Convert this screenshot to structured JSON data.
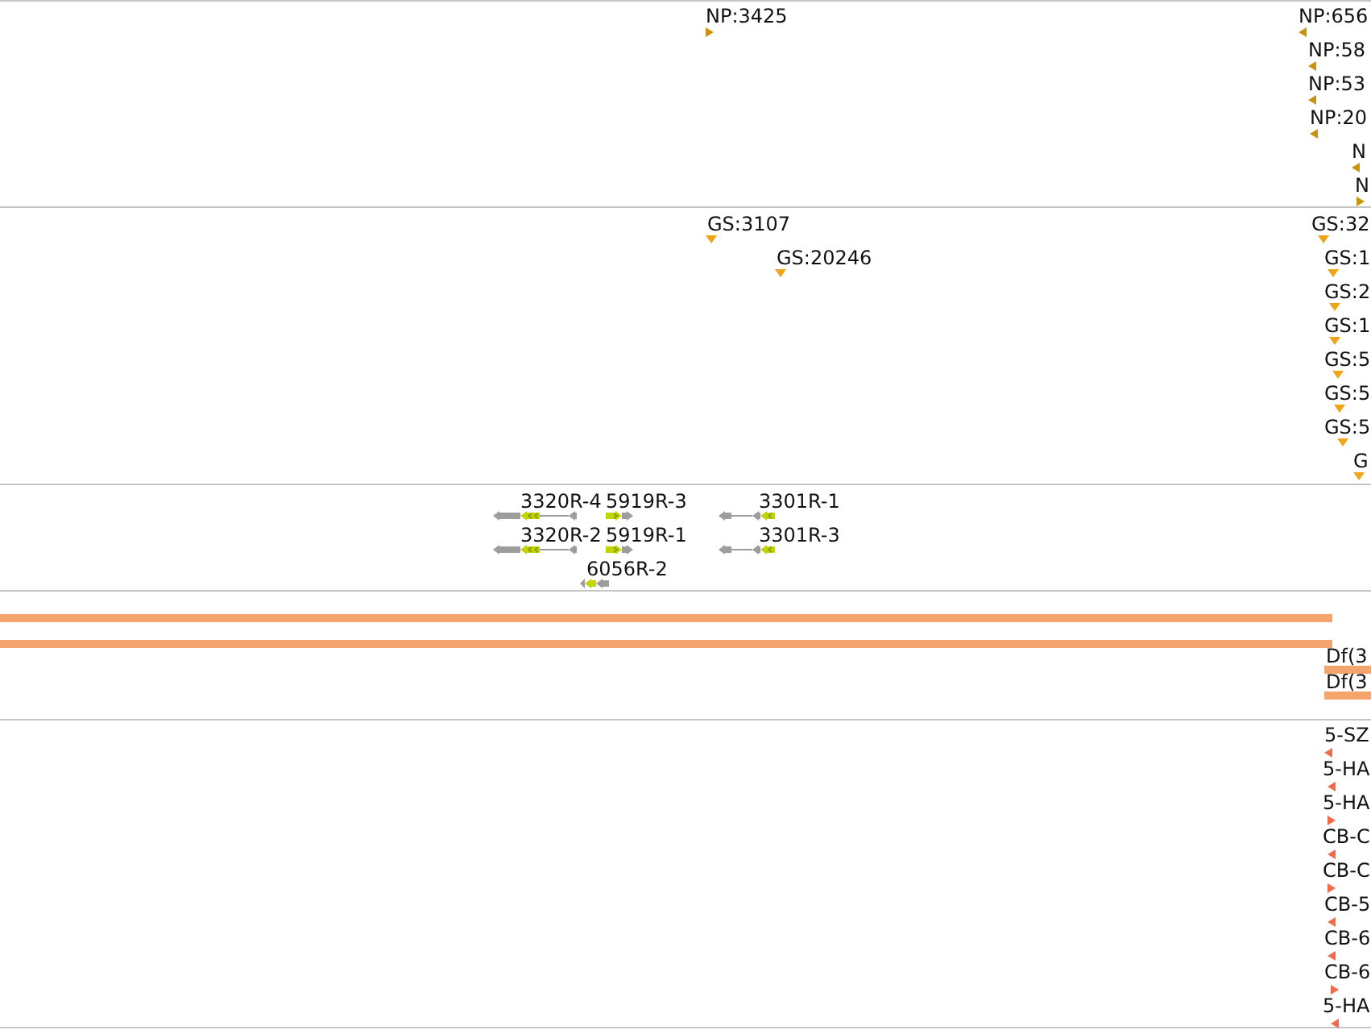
{
  "tracks": [
    {
      "kind": "arrows",
      "features": [
        {
          "label": "NP:3425",
          "reverse": false
        },
        {
          "label": "NP:656",
          "reverse": true
        },
        {
          "label": "NP:58",
          "reverse": true
        },
        {
          "label": "NP:53",
          "reverse": true
        },
        {
          "label": "NP:20",
          "reverse": true
        },
        {
          "label": "N",
          "reverse": true
        },
        {
          "label": "N",
          "reverse": false
        }
      ]
    },
    {
      "kind": "pins",
      "features": [
        {
          "label": "GS:3107"
        },
        {
          "label": "GS:32"
        },
        {
          "label": "GS:20246"
        },
        {
          "label": "GS:1"
        },
        {
          "label": "GS:2"
        },
        {
          "label": "GS:1"
        },
        {
          "label": "GS:5"
        },
        {
          "label": "GS:5"
        },
        {
          "label": "GS:5"
        },
        {
          "label": "G"
        }
      ]
    },
    {
      "kind": "genes",
      "features": [
        {
          "label": "3320R-4",
          "reverse": true
        },
        {
          "label": "5919R-3",
          "reverse": false
        },
        {
          "label": "3301R-1",
          "reverse": true
        },
        {
          "label": "3320R-2",
          "reverse": true
        },
        {
          "label": "5919R-1",
          "reverse": false
        },
        {
          "label": "3301R-3",
          "reverse": true
        },
        {
          "label": "6056R-2",
          "reverse": true
        }
      ]
    },
    {
      "kind": "bars",
      "features": [
        {
          "kind": "plain"
        },
        {
          "kind": "plain"
        },
        {
          "kind": "labeled",
          "label": "Df(3"
        },
        {
          "kind": "labeled",
          "label": "Df(3"
        }
      ]
    },
    {
      "kind": "arrows",
      "features": [
        {
          "label": "5-SZ",
          "reverse": true
        },
        {
          "label": "5-HA",
          "reverse": true
        },
        {
          "label": "5-HA",
          "reverse": false
        },
        {
          "label": "CB-C",
          "reverse": true
        },
        {
          "label": "CB-C",
          "reverse": false
        },
        {
          "label": "CB-5",
          "reverse": true
        },
        {
          "label": "CB-6",
          "reverse": true
        },
        {
          "label": "CB-6",
          "reverse": false
        },
        {
          "label": "5-HA",
          "reverse": true
        }
      ]
    }
  ]
}
